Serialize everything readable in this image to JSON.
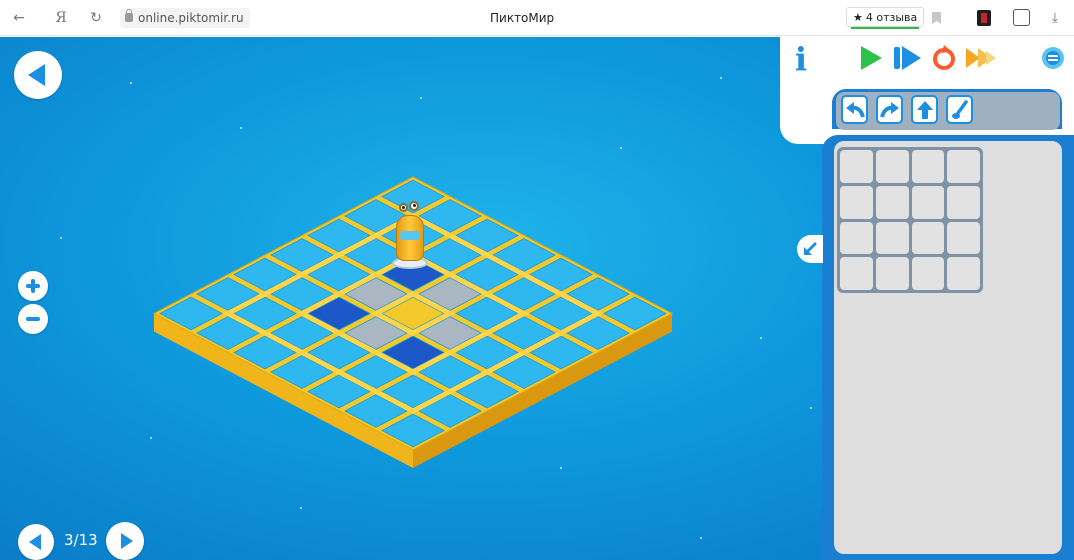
{
  "browser": {
    "back_glyph": "←",
    "ya_glyph": "Я",
    "reload_glyph": "↻",
    "address": "online.piktomir.ru",
    "page_title": "ПиктоМир",
    "reviews_star": "★",
    "reviews_label": "4 отзыва",
    "download_glyph": "⤓"
  },
  "game": {
    "level_counter": "3/13"
  },
  "toolbar": {
    "buttons": [
      "info-icon",
      "play-icon",
      "step-icon",
      "reset-icon",
      "fast-forward-icon",
      "settings-icon"
    ]
  },
  "commands": [
    "turn-left-icon",
    "turn-right-icon",
    "forward-icon",
    "paint-icon"
  ],
  "program": {
    "rows": 4,
    "cols": 4
  },
  "colors": {
    "accent": "#1d8fe0",
    "play": "#2ec24a",
    "reset": "#ff5a2b",
    "fast_forward": "#f5a623",
    "board_gold": "#f3c92b",
    "tile": "#2fb8ef"
  }
}
